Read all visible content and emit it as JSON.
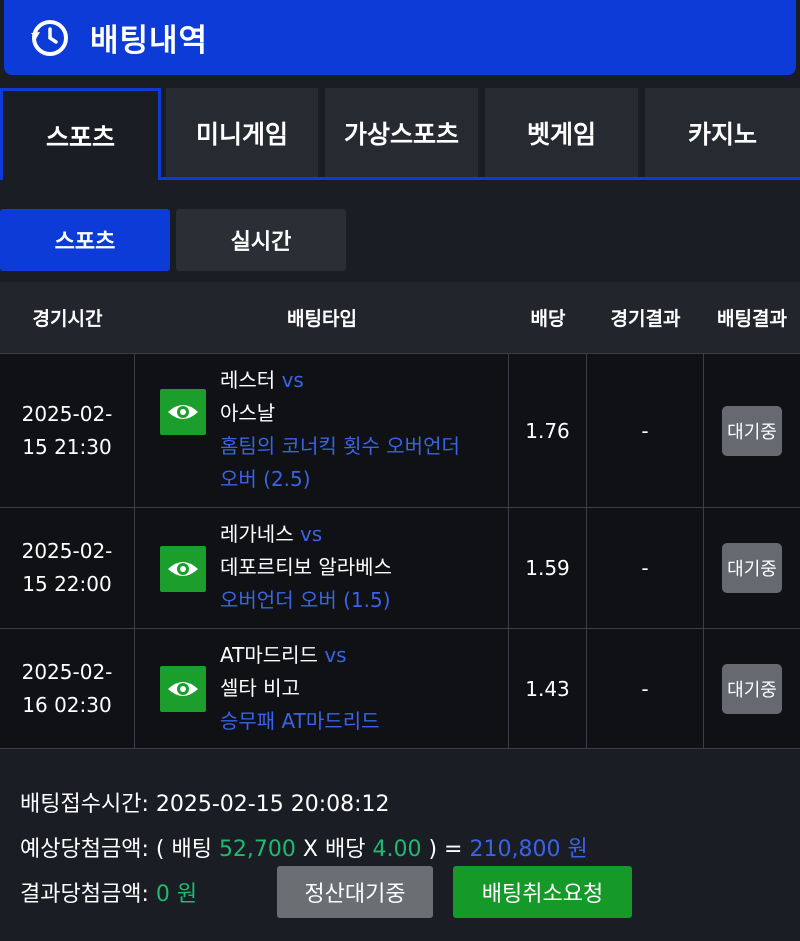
{
  "header": {
    "title": "배팅내역",
    "icon": "clock-history-icon"
  },
  "tabs": [
    {
      "label": "스포츠"
    },
    {
      "label": "미니게임"
    },
    {
      "label": "가상스포츠"
    },
    {
      "label": "벳게임"
    },
    {
      "label": "카지노"
    }
  ],
  "subtabs": [
    {
      "label": "스포츠"
    },
    {
      "label": "실시간"
    }
  ],
  "table": {
    "headers": [
      "경기시간",
      "배팅타입",
      "배당",
      "경기결과",
      "배팅결과"
    ],
    "rows": [
      {
        "date": "2025-02-",
        "time": "15 21:30",
        "home": "레스터",
        "vs": "vs",
        "away": "아스날",
        "market": "홈팀의 코너킥 횟수 오버언더",
        "pick": "오버 (2.5)",
        "odds": "1.76",
        "result": "-",
        "status": "대기중"
      },
      {
        "date": "2025-02-",
        "time": "15 22:00",
        "home": "레가네스",
        "vs": "vs",
        "away": "데포르티보 알라베스",
        "market": "오버언더 오버 (1.5)",
        "pick": "",
        "odds": "1.59",
        "result": "-",
        "status": "대기중"
      },
      {
        "date": "2025-02-",
        "time": "16 02:30",
        "home": "AT마드리드",
        "vs": "vs",
        "away": "셀타 비고",
        "market": "승무패 AT마드리드",
        "pick": "",
        "odds": "1.43",
        "result": "-",
        "status": "대기중"
      }
    ]
  },
  "footer": {
    "receipt_label": "배팅접수시간:",
    "receipt_time": "2025-02-15 20:08:12",
    "expected_label": "예상당첨금액:",
    "open_paren": "(",
    "bet_label": "배팅",
    "bet_amount": "52,700",
    "times": "X",
    "odds_label": "배당",
    "total_odds": "4.00",
    "close_eq": ") =",
    "expected_amount": "210,800 원",
    "result_label": "결과당첨금액:",
    "result_amount": "0 원",
    "settle_button": "정산대기중",
    "cancel_button": "배팅취소요청"
  },
  "colors": {
    "brand_blue": "#0c3bd8",
    "accent_green": "#21b872",
    "link_blue": "#3a63e6",
    "button_green": "#159a2a"
  }
}
